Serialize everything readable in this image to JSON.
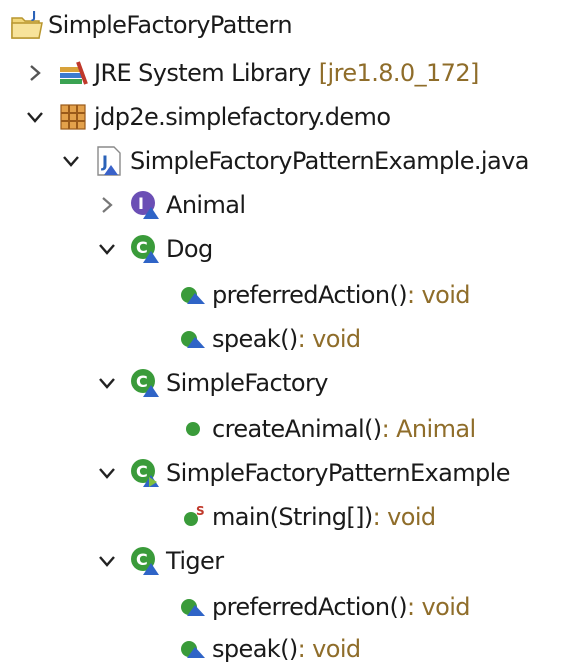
{
  "tree": {
    "project": {
      "label": "SimpleFactoryPattern",
      "icon": "java-project-icon"
    },
    "jre": {
      "label": "JRE System Library",
      "version": "[jre1.8.0_172]",
      "icon": "library-icon"
    },
    "package": {
      "label": "jdp2e.simplefactory.demo",
      "icon": "package-icon"
    },
    "file": {
      "label": "SimpleFactoryPatternExample.java",
      "icon": "java-file-icon"
    },
    "animal": {
      "label": "Animal",
      "icon": "interface-icon"
    },
    "dog": {
      "label": "Dog",
      "icon": "class-icon",
      "m1": {
        "name": "preferredAction()",
        "type": " : void"
      },
      "m2": {
        "name": "speak()",
        "type": " : void"
      }
    },
    "factory": {
      "label": "SimpleFactory",
      "icon": "class-icon",
      "m1": {
        "name": "createAnimal()",
        "type": " : Animal"
      }
    },
    "example": {
      "label": "SimpleFactoryPatternExample",
      "icon": "class-icon",
      "m1": {
        "name": "main(String[])",
        "type": " : void"
      }
    },
    "tiger": {
      "label": "Tiger",
      "icon": "class-icon",
      "m1": {
        "name": "preferredAction()",
        "type": " : void"
      },
      "m2": {
        "name": "speak()",
        "type": " : void"
      }
    }
  },
  "colors": {
    "type_text": "#8f6d2a",
    "class_green": "#3a9b3a",
    "interface_purple": "#6b4fb5"
  }
}
